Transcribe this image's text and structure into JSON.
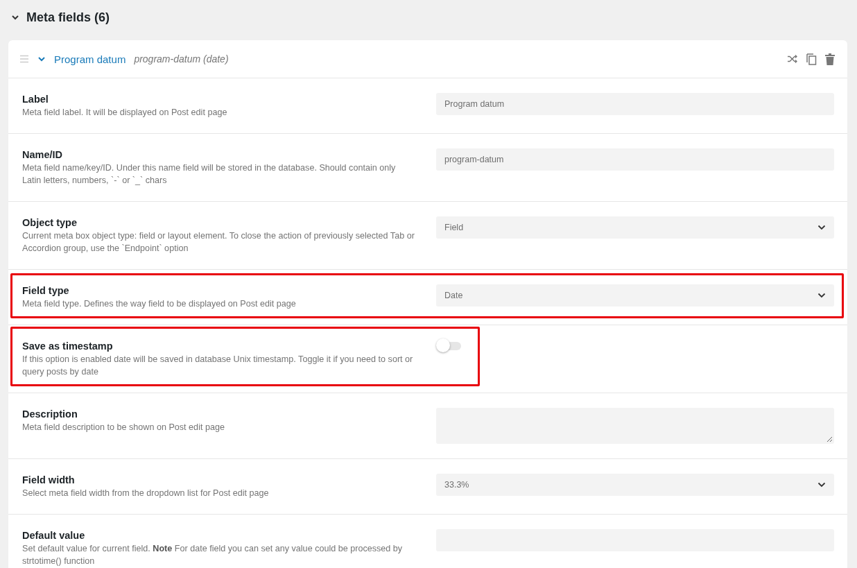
{
  "section": {
    "title": "Meta fields (6)",
    "expanded": true
  },
  "field": {
    "title": "Program datum",
    "slug": "program-datum (date)",
    "expanded": true,
    "rows": [
      {
        "title": "Label",
        "description": "Meta field label. It will be displayed on Post edit page",
        "kind": "text",
        "value": "Program datum",
        "highlighted": false
      },
      {
        "title": "Name/ID",
        "description": "Meta field name/key/ID. Under this name field will be stored in the database. Should contain only Latin letters, numbers, `-` or `_` chars",
        "kind": "text",
        "value": "program-datum",
        "highlighted": false
      },
      {
        "title": "Object type",
        "description": "Current meta box object type: field or layout element. To close the action of previously selected Tab or Accordion group, use the `Endpoint` option",
        "kind": "select",
        "value": "Field",
        "highlighted": false
      },
      {
        "title": "Field type",
        "description": "Meta field type. Defines the way field to be displayed on Post edit page",
        "kind": "select",
        "value": "Date",
        "highlighted": true
      },
      {
        "title": "Save as timestamp",
        "description": "If this option is enabled date will be saved in database Unix timestamp. Toggle it if you need to sort or query posts by date",
        "kind": "toggle",
        "on": false,
        "highlighted": true
      },
      {
        "title": "Description",
        "description": "Meta field description to be shown on Post edit page",
        "kind": "textarea",
        "highlighted": false
      },
      {
        "title": "Field width",
        "description": "Select meta field width from the dropdown list for Post edit page",
        "kind": "select",
        "value": "33.3%",
        "highlighted": false
      },
      {
        "title": "Default value",
        "description": "Set default value for current field. **Note** For date field you can set any value could be processed by strtotime() function",
        "kind": "text",
        "value": "",
        "highlighted": false
      }
    ]
  }
}
